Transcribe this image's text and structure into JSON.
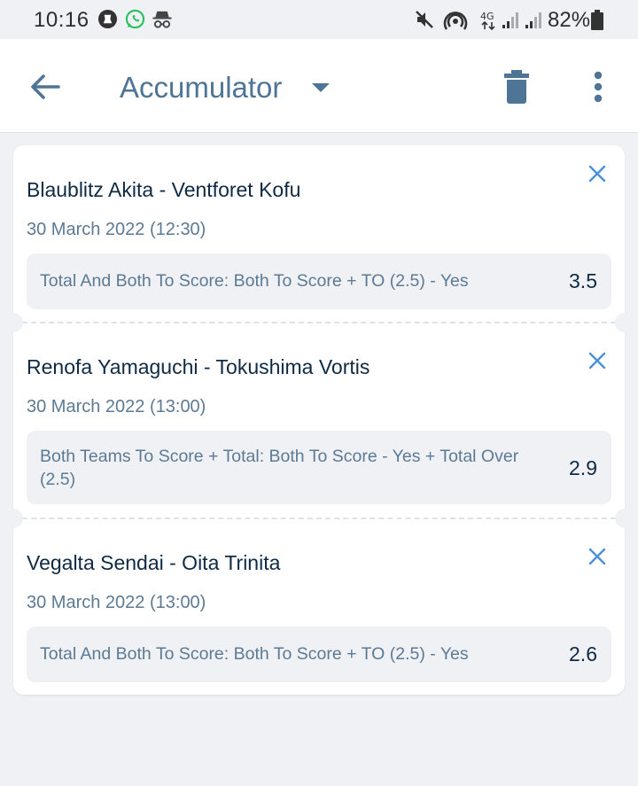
{
  "status_bar": {
    "time": "10:16",
    "battery": "82%",
    "icons": [
      "chelsea-app-icon",
      "whatsapp-icon",
      "incognito-icon",
      "mute-icon",
      "hotspot-icon",
      "4g-icon",
      "signal-icon",
      "signal-icon",
      "battery-icon"
    ]
  },
  "appbar": {
    "title": "Accumulator",
    "icons": [
      "back-arrow-icon",
      "dropdown-caret-icon",
      "trash-icon",
      "more-vert-icon"
    ]
  },
  "colors": {
    "accent": "#4f7596",
    "text_dark": "#0f2a44",
    "text_muted": "#5d7a94",
    "background": "#eff1f5"
  },
  "bets": [
    {
      "match": "Blaublitz Akita - Ventforet Kofu",
      "date": "30 March 2022 (12:30)",
      "market": "Total And Both To Score: Both To Score + TO (2.5) - Yes",
      "odds": "3.5"
    },
    {
      "match": "Renofa Yamaguchi - Tokushima Vortis",
      "date": "30 March 2022 (13:00)",
      "market": "Both Teams To Score + Total: Both To Score - Yes + Total Over (2.5)",
      "odds": "2.9"
    },
    {
      "match": "Vegalta Sendai - Oita Trinita",
      "date": "30 March 2022 (13:00)",
      "market": "Total And Both To Score: Both To Score + TO (2.5) - Yes",
      "odds": "2.6"
    }
  ]
}
